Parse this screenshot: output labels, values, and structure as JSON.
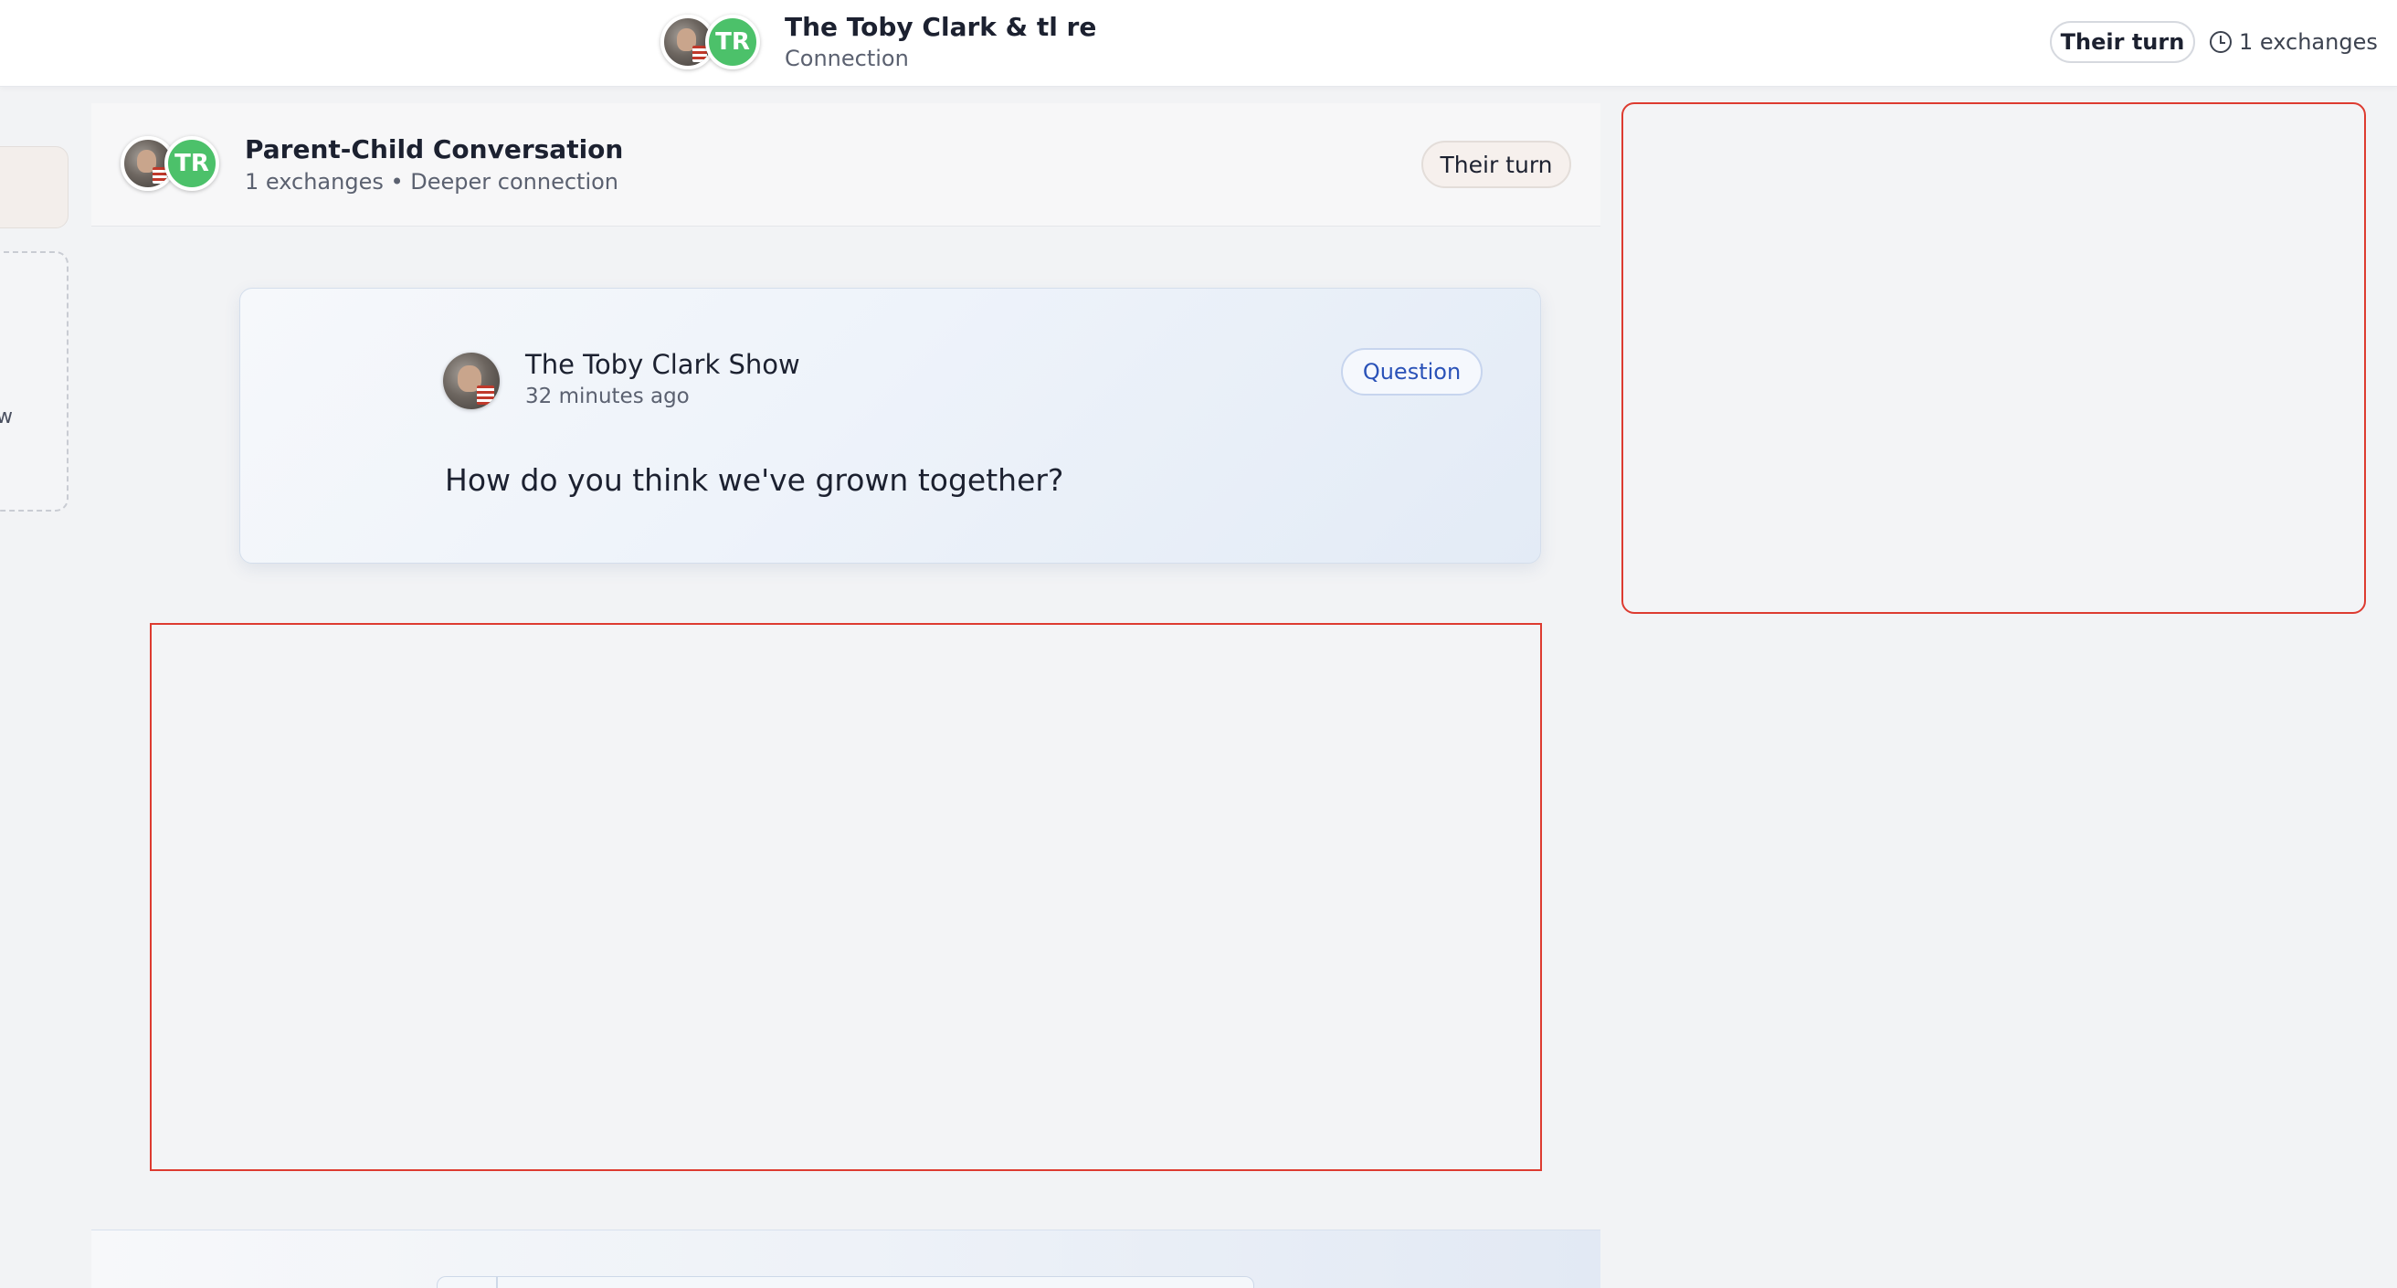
{
  "header": {
    "title": "The Toby Clark & tl re",
    "subtitle": "Connection",
    "turn_label": "Their turn",
    "exchanges_label": "1 exchanges",
    "partner_initials": "TR"
  },
  "sidebar": {
    "partial_letter": "w"
  },
  "conversation": {
    "title": "Parent-Child Conversation",
    "meta": "1 exchanges • Deeper connection",
    "turn_label": "Their turn",
    "partner_initials": "TR"
  },
  "question_card": {
    "author": "The Toby Clark Show",
    "time": "32 minutes ago",
    "badge": "Question",
    "text": "How do you think we've grown together?"
  },
  "colors": {
    "accent_blue": "#2a52b8",
    "avatar_green": "#4cc16a",
    "placeholder_border": "#dd3b30"
  },
  "icons": [
    "clock-icon"
  ]
}
